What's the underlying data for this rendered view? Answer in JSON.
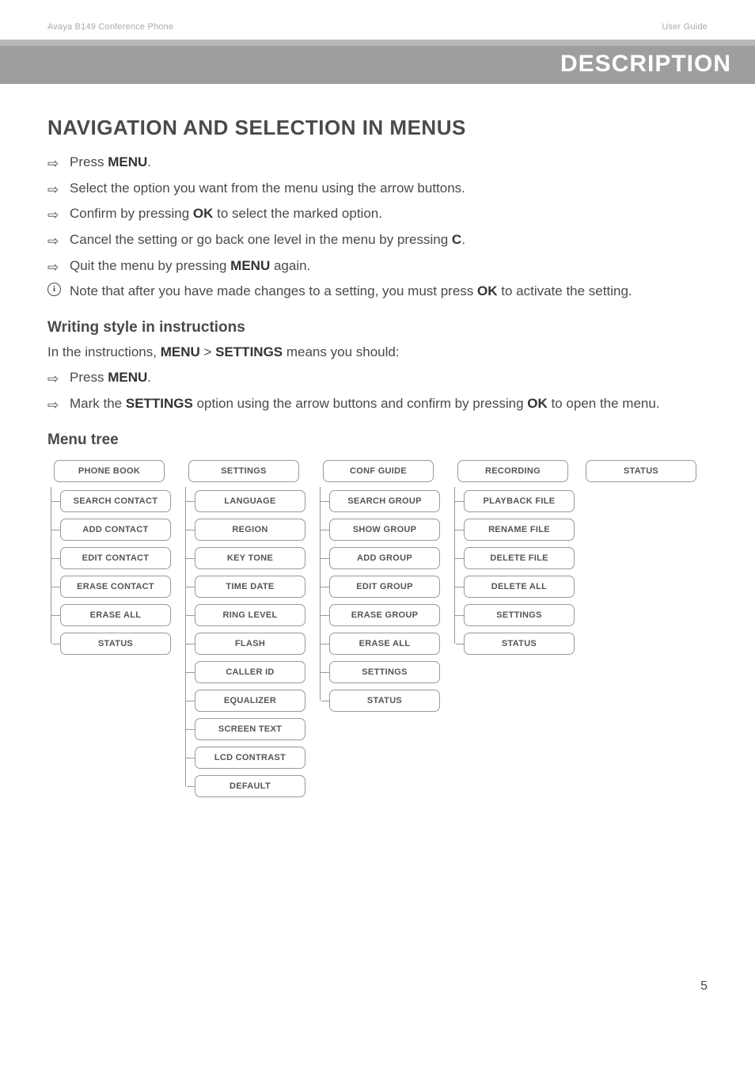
{
  "header": {
    "left": "Avaya B149 Conference Phone",
    "right": "User Guide"
  },
  "ribbon": "DESCRIPTION",
  "section_title": "NAVIGATION AND SELECTION IN MENUS",
  "steps_a": [
    {
      "pre": "Press ",
      "b1": "MENU",
      "post": "."
    },
    {
      "pre": "Select the option you want from the menu using the arrow buttons."
    },
    {
      "pre": "Confirm by pressing ",
      "b1": "OK",
      "post": " to select the marked option."
    },
    {
      "pre": "Cancel the setting or go back one level in the menu by pressing ",
      "b1": "C",
      "post": "."
    },
    {
      "pre": "Quit the menu by pressing ",
      "b1": "MENU",
      "post": " again."
    }
  ],
  "info_step": {
    "pre": "Note that after you have made changes to a setting, you must press ",
    "b1": "OK",
    "post": " to activate the setting."
  },
  "sub1": "Writing style in instructions",
  "writing_intro": {
    "pre": "In the instructions, ",
    "b1": "MENU",
    "mid": " > ",
    "b2": "SETTINGS",
    "post": " means you should:"
  },
  "steps_b": [
    {
      "pre": "Press ",
      "b1": "MENU",
      "post": "."
    },
    {
      "pre": "Mark the ",
      "b1": "SETTINGS",
      "mid": " option using the arrow buttons and confirm by pressing ",
      "b2": "OK",
      "post": " to open the menu."
    }
  ],
  "sub2": "Menu tree",
  "tree": {
    "cols": [
      {
        "root": "PHONE BOOK",
        "children": [
          "SEARCH CONTACT",
          "ADD CONTACT",
          "EDIT CONTACT",
          "ERASE CONTACT",
          "ERASE ALL",
          "STATUS"
        ]
      },
      {
        "root": "SETTINGS",
        "children": [
          "LANGUAGE",
          "REGION",
          "KEY TONE",
          "TIME DATE",
          "RING LEVEL",
          "FLASH",
          "CALLER ID",
          "EQUALIZER",
          "SCREEN TEXT",
          "LCD CONTRAST",
          "DEFAULT"
        ]
      },
      {
        "root": "CONF GUIDE",
        "children": [
          "SEARCH GROUP",
          "SHOW GROUP",
          "ADD GROUP",
          "EDIT GROUP",
          "ERASE GROUP",
          "ERASE ALL",
          "SETTINGS",
          "STATUS"
        ]
      },
      {
        "root": "RECORDING",
        "children": [
          "PLAYBACK FILE",
          "RENAME FILE",
          "DELETE FILE",
          "DELETE ALL",
          "SETTINGS",
          "STATUS"
        ]
      },
      {
        "root": "STATUS",
        "children": []
      }
    ]
  },
  "page_number": "5"
}
